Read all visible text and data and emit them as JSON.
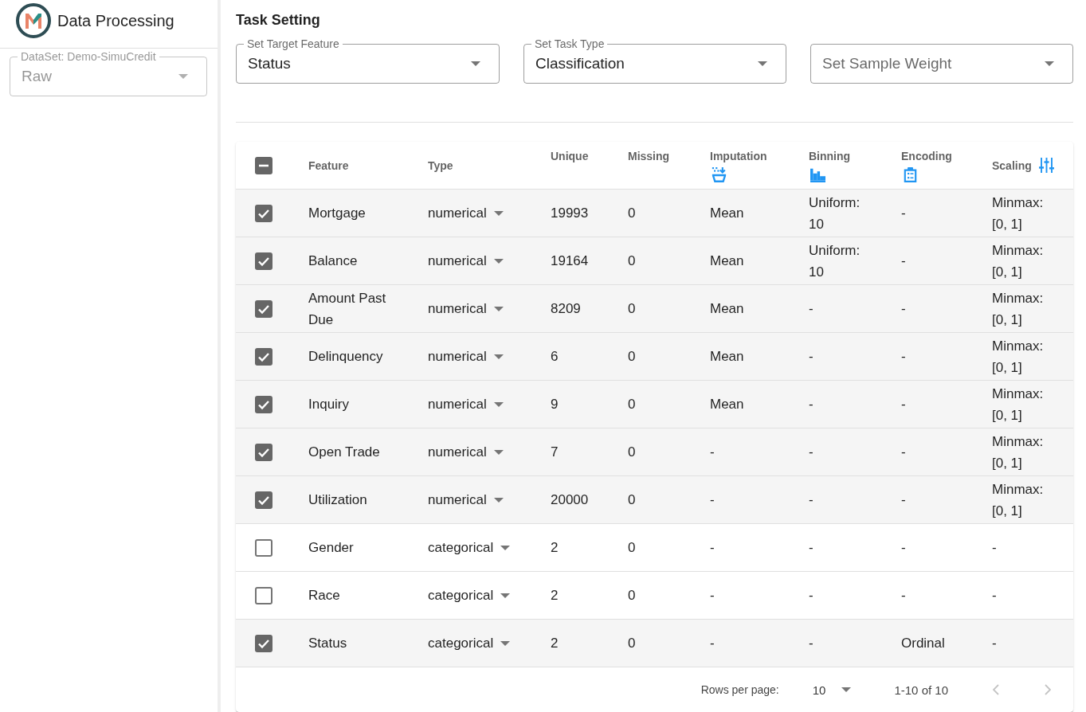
{
  "app_bar": {
    "title": "Data Processing"
  },
  "sidebar": {
    "dataset_select": {
      "label": "DataSet: Demo-SimuCredit",
      "value": "Raw",
      "disabled": true
    }
  },
  "task_setting": {
    "title": "Task Setting",
    "selects": [
      {
        "label": "Set Target Feature",
        "value": "Status"
      },
      {
        "label": "Set Task Type",
        "value": "Classification"
      },
      {
        "placeholder": "Set Sample Weight"
      }
    ]
  },
  "table": {
    "select_all": {
      "indeterminate": true
    },
    "columns": [
      {
        "label": "Feature",
        "kind": "plain"
      },
      {
        "label": "Type",
        "kind": "plain"
      },
      {
        "label": "Unique",
        "kind": "stacked"
      },
      {
        "label": "Missing",
        "kind": "stacked"
      },
      {
        "label": "Imputation",
        "kind": "stacked"
      },
      {
        "label": "Binning",
        "kind": "stacked"
      },
      {
        "label": "Encoding",
        "kind": "stacked"
      },
      {
        "label": "Scaling",
        "kind": "icon_right"
      }
    ],
    "rows": [
      {
        "selected": true,
        "feature": "Mortgage",
        "type": "numerical",
        "unique": "19993",
        "missing": "0",
        "imputation": "Mean",
        "binning": "Uniform: 10",
        "encoding": "-",
        "scaling": "Minmax: [0, 1]"
      },
      {
        "selected": true,
        "feature": "Balance",
        "type": "numerical",
        "unique": "19164",
        "missing": "0",
        "imputation": "Mean",
        "binning": "Uniform: 10",
        "encoding": "-",
        "scaling": "Minmax: [0, 1]"
      },
      {
        "selected": true,
        "feature": "Amount Past Due",
        "type": "numerical",
        "unique": "8209",
        "missing": "0",
        "imputation": "Mean",
        "binning": "-",
        "encoding": "-",
        "scaling": "Minmax: [0, 1]"
      },
      {
        "selected": true,
        "feature": "Delinquency",
        "type": "numerical",
        "unique": "6",
        "missing": "0",
        "imputation": "Mean",
        "binning": "-",
        "encoding": "-",
        "scaling": "Minmax: [0, 1]"
      },
      {
        "selected": true,
        "feature": "Inquiry",
        "type": "numerical",
        "unique": "9",
        "missing": "0",
        "imputation": "Mean",
        "binning": "-",
        "encoding": "-",
        "scaling": "Minmax: [0, 1]"
      },
      {
        "selected": true,
        "feature": "Open Trade",
        "type": "numerical",
        "unique": "7",
        "missing": "0",
        "imputation": "-",
        "binning": "-",
        "encoding": "-",
        "scaling": "Minmax: [0, 1]"
      },
      {
        "selected": true,
        "feature": "Utilization",
        "type": "numerical",
        "unique": "20000",
        "missing": "0",
        "imputation": "-",
        "binning": "-",
        "encoding": "-",
        "scaling": "Minmax: [0, 1]"
      },
      {
        "selected": false,
        "feature": "Gender",
        "type": "categorical",
        "unique": "2",
        "missing": "0",
        "imputation": "-",
        "binning": "-",
        "encoding": "-",
        "scaling": "-"
      },
      {
        "selected": false,
        "feature": "Race",
        "type": "categorical",
        "unique": "2",
        "missing": "0",
        "imputation": "-",
        "binning": "-",
        "encoding": "-",
        "scaling": "-"
      },
      {
        "selected": true,
        "feature": "Status",
        "type": "categorical",
        "unique": "2",
        "missing": "0",
        "imputation": "-",
        "binning": "-",
        "encoding": "Ordinal",
        "scaling": "-"
      }
    ],
    "footer": {
      "rows_per_page_label": "Rows per page:",
      "rows_per_page": "10",
      "range": "1-10 of 10",
      "prev": {
        "disabled": true
      },
      "next": {
        "disabled": true
      }
    }
  }
}
